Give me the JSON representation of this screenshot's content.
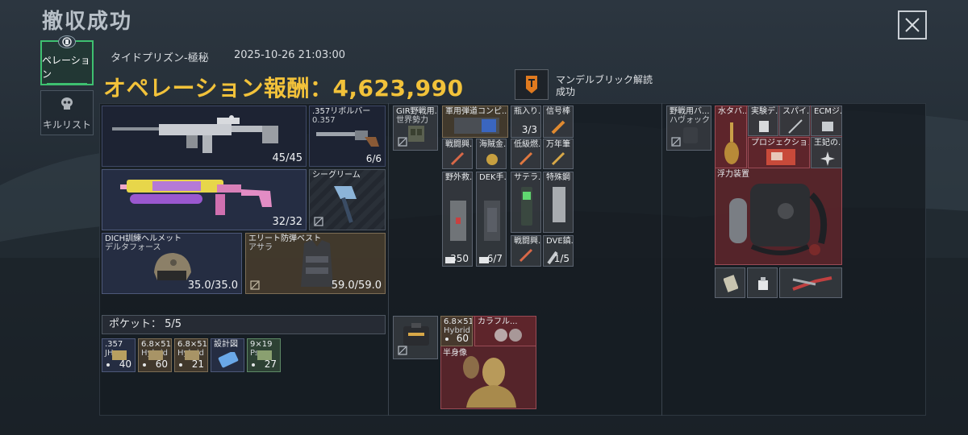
{
  "title": "撤収成功",
  "sidebar": {
    "tabs": [
      {
        "label": "ペレーション",
        "active": true,
        "icon": "operation-icon"
      },
      {
        "label": "キルリスト",
        "active": false,
        "icon": "skull-icon"
      }
    ]
  },
  "header": {
    "map_name": "タイドプリズン-極秘",
    "datetime": "2025-10-26 21:03:00",
    "reward": "オペレーション報酬：4,623,990",
    "unlock": {
      "line1": "マンデルブリック解読",
      "line2": "成功"
    }
  },
  "weapons": {
    "primary": {
      "count": "45/45"
    },
    "sidearm": {
      "name": ".357リボルバー",
      "caliber": "0.357",
      "count": "6/6"
    },
    "secondary": {
      "count": "32/32"
    },
    "melee": {
      "name": "シーグリーム"
    },
    "helmet": {
      "line1": "DICH訓練ヘルメット",
      "line2": "デルタフォース",
      "durability": "35.0/35.0"
    },
    "armor": {
      "line1": "エリート防弾ベスト",
      "line2": "アサラ",
      "durability": "59.0/59.0"
    }
  },
  "pocket": {
    "label": "ポケット：",
    "value": "5/5",
    "items": [
      {
        "line1": ".357",
        "line2": "JH",
        "count": "40"
      },
      {
        "line1": "6.8×51",
        "line2": "Hybrid",
        "count": "60"
      },
      {
        "line1": "6.8×51",
        "line2": "Hybrid",
        "count": "21"
      },
      {
        "line1": "設計図",
        "line2": "",
        "count": ""
      },
      {
        "line1": "9×19",
        "line2": "Pso",
        "count": "27"
      }
    ]
  },
  "rig": {
    "item": {
      "line1": "GIR野戦用...",
      "line2": "世界勢力"
    },
    "grid": [
      {
        "name": "軍用弾道コンピ..."
      },
      {
        "name": "瓶入り...",
        "count": "3/3"
      },
      {
        "name": "信号棒"
      },
      {
        "name": "戦闘興..."
      },
      {
        "name": "海賊金..."
      },
      {
        "name": "低級燃..."
      },
      {
        "name": "万年筆"
      },
      {
        "name": "野外救...",
        "count": "350"
      },
      {
        "name": "DEK手...",
        "count": "6/7"
      },
      {
        "name": "サテラ..."
      },
      {
        "name": "特殊鋼"
      },
      {
        "name": "戦闘興..."
      },
      {
        "name": "DVE鎮...",
        "count": "1/5"
      }
    ]
  },
  "case": {
    "items": [
      {
        "line1": "6.8×51",
        "line2": "Hybrid",
        "count": "60"
      },
      {
        "name": "カラフル..."
      },
      {
        "name": "半身像"
      }
    ]
  },
  "backpack": {
    "item": {
      "line1": "野戦用バ...",
      "line2": "ハヴォック"
    },
    "grid": [
      {
        "name": "水タバ..."
      },
      {
        "name": "実験デ..."
      },
      {
        "name": "スパイ..."
      },
      {
        "name": "ECMジ..."
      },
      {
        "name": "プロジェクション..."
      },
      {
        "name": "王妃の..."
      },
      {
        "name": "浮力装置"
      }
    ]
  }
}
